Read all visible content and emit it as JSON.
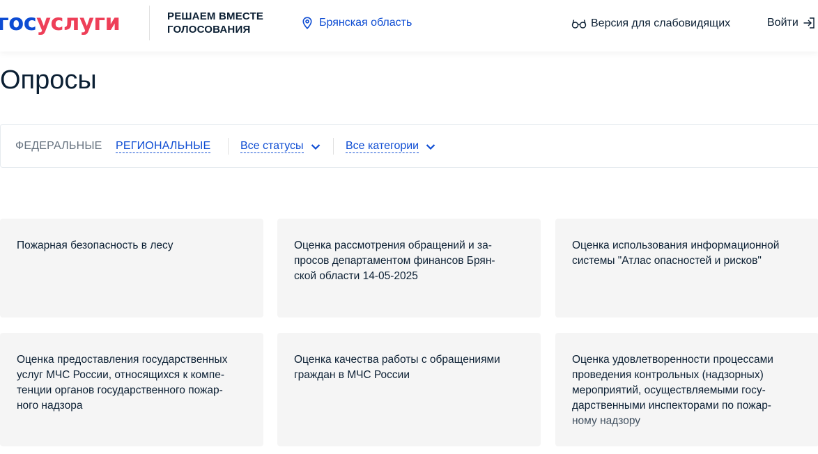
{
  "header": {
    "logo_part1": "гос",
    "logo_part2": "услуги",
    "slogan_line1": "РЕШАЕМ ВМЕСТЕ",
    "slogan_line2": "ГОЛОСОВАНИЯ",
    "region": "Брянская область",
    "vision_mode": "Версия для слабовидящих",
    "login": "Войти"
  },
  "page": {
    "title": "Опросы"
  },
  "filters": {
    "tab_federal": "ФЕДЕРАЛЬНЫЕ",
    "tab_regional": "РЕГИОНАЛЬНЫЕ",
    "status_select": "Все статусы",
    "category_select": "Все категории"
  },
  "polls": [
    {
      "lines": [
        "Пожарная безопасность в лесу"
      ]
    },
    {
      "lines": [
        "Оценка рассмотрения обращений и за-",
        "просов департаментом финансов Брян-",
        "ской области 14-05-2025"
      ]
    },
    {
      "lines": [
        "Оценка использования информационной",
        "системы \"Атлас опасностей и рисков\""
      ]
    },
    {
      "lines": [
        "Оценка предоставления государственных",
        "услуг МЧС России, относящихся к компе-",
        "тенции органов государственного пожар-",
        "ного надзора"
      ]
    },
    {
      "lines": [
        "Оценка качества работы с обращениями",
        "граждан в МЧС России"
      ]
    },
    {
      "lines": [
        "Оценка удовлетворенности процессами",
        "проведения контрольных (надзорных)",
        "мероприятий, осуществляемыми госу-",
        "дарственными инспекторами по пожар-",
        "ному надзору"
      ]
    }
  ],
  "colors": {
    "brand_blue": "#0d4cd3",
    "brand_red": "#ee3f58",
    "card_bg": "#f5f5f5",
    "text": "#0b1f33",
    "muted": "#66727f"
  },
  "icons": {
    "region": "location-pin-icon",
    "vision": "glasses-icon",
    "login": "login-arrow-icon",
    "dropdown": "chevron-down-icon"
  }
}
